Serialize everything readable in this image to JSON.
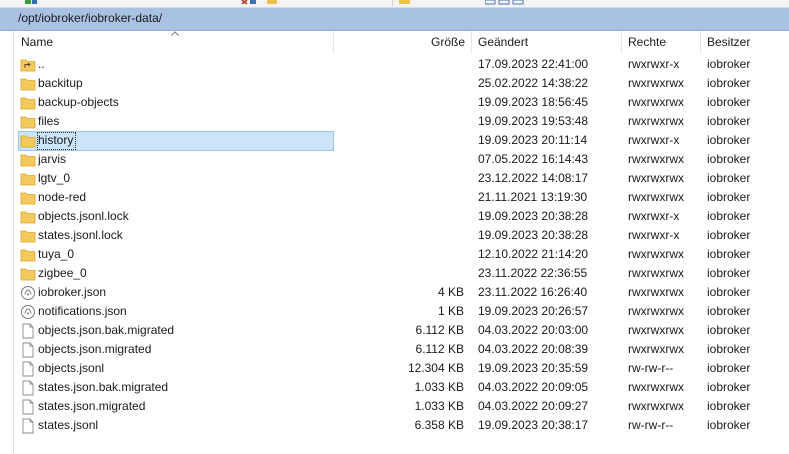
{
  "path": "/opt/iobroker/iobroker-data/",
  "columns": {
    "name": "Name",
    "size": "Größe",
    "modified": "Geändert",
    "rights": "Rechte",
    "owner": "Besitzer"
  },
  "colors": {
    "pathbar": "#a9c2e3",
    "selection": "#cce4f7",
    "folder": "#f4c95d"
  },
  "rows": [
    {
      "icon": "parent-folder-icon",
      "name": "..",
      "size": "",
      "modified": "17.09.2023 22:41:00",
      "rights": "rwxrwxr-x",
      "owner": "iobroker"
    },
    {
      "icon": "folder-icon",
      "name": "backitup",
      "size": "",
      "modified": "25.02.2022 14:38:22",
      "rights": "rwxrwxrwx",
      "owner": "iobroker"
    },
    {
      "icon": "folder-icon",
      "name": "backup-objects",
      "size": "",
      "modified": "19.09.2023 18:56:45",
      "rights": "rwxrwxrwx",
      "owner": "iobroker"
    },
    {
      "icon": "folder-icon",
      "name": "files",
      "size": "",
      "modified": "19.09.2023 19:53:48",
      "rights": "rwxrwxrwx",
      "owner": "iobroker"
    },
    {
      "icon": "folder-icon",
      "name": "history",
      "size": "",
      "modified": "19.09.2023 20:11:14",
      "rights": "rwxrwxr-x",
      "owner": "iobroker",
      "selected": true
    },
    {
      "icon": "folder-icon",
      "name": "jarvis",
      "size": "",
      "modified": "07.05.2022 16:14:43",
      "rights": "rwxrwxrwx",
      "owner": "iobroker"
    },
    {
      "icon": "folder-icon",
      "name": "lgtv_0",
      "size": "",
      "modified": "23.12.2022 14:08:17",
      "rights": "rwxrwxrwx",
      "owner": "iobroker"
    },
    {
      "icon": "folder-icon",
      "name": "node-red",
      "size": "",
      "modified": "21.11.2021 13:19:30",
      "rights": "rwxrwxrwx",
      "owner": "iobroker"
    },
    {
      "icon": "folder-icon",
      "name": "objects.jsonl.lock",
      "size": "",
      "modified": "19.09.2023 20:38:28",
      "rights": "rwxrwxr-x",
      "owner": "iobroker"
    },
    {
      "icon": "folder-icon",
      "name": "states.jsonl.lock",
      "size": "",
      "modified": "19.09.2023 20:38:28",
      "rights": "rwxrwxr-x",
      "owner": "iobroker"
    },
    {
      "icon": "folder-icon",
      "name": "tuya_0",
      "size": "",
      "modified": "12.10.2022 21:14:20",
      "rights": "rwxrwxrwx",
      "owner": "iobroker"
    },
    {
      "icon": "folder-icon",
      "name": "zigbee_0",
      "size": "",
      "modified": "23.11.2022 22:36:55",
      "rights": "rwxrwxrwx",
      "owner": "iobroker"
    },
    {
      "icon": "json-file-icon",
      "name": "iobroker.json",
      "size": "4 KB",
      "modified": "23.11.2022 16:26:40",
      "rights": "rwxrwxrwx",
      "owner": "iobroker"
    },
    {
      "icon": "json-file-icon",
      "name": "notifications.json",
      "size": "1 KB",
      "modified": "19.09.2023 20:26:57",
      "rights": "rwxrwxrwx",
      "owner": "iobroker"
    },
    {
      "icon": "file-icon",
      "name": "objects.json.bak.migrated",
      "size": "6.112 KB",
      "modified": "04.03.2022 20:03:00",
      "rights": "rwxrwxrwx",
      "owner": "iobroker"
    },
    {
      "icon": "file-icon",
      "name": "objects.json.migrated",
      "size": "6.112 KB",
      "modified": "04.03.2022 20:08:39",
      "rights": "rwxrwxrwx",
      "owner": "iobroker"
    },
    {
      "icon": "file-icon",
      "name": "objects.jsonl",
      "size": "12.304 KB",
      "modified": "19.09.2023 20:35:59",
      "rights": "rw-rw-r--",
      "owner": "iobroker"
    },
    {
      "icon": "file-icon",
      "name": "states.json.bak.migrated",
      "size": "1.033 KB",
      "modified": "04.03.2022 20:09:05",
      "rights": "rwxrwxrwx",
      "owner": "iobroker"
    },
    {
      "icon": "file-icon",
      "name": "states.json.migrated",
      "size": "1.033 KB",
      "modified": "04.03.2022 20:09:27",
      "rights": "rwxrwxrwx",
      "owner": "iobroker"
    },
    {
      "icon": "file-icon",
      "name": "states.jsonl",
      "size": "6.358 KB",
      "modified": "19.09.2023 20:38:17",
      "rights": "rw-rw-r--",
      "owner": "iobroker"
    }
  ]
}
